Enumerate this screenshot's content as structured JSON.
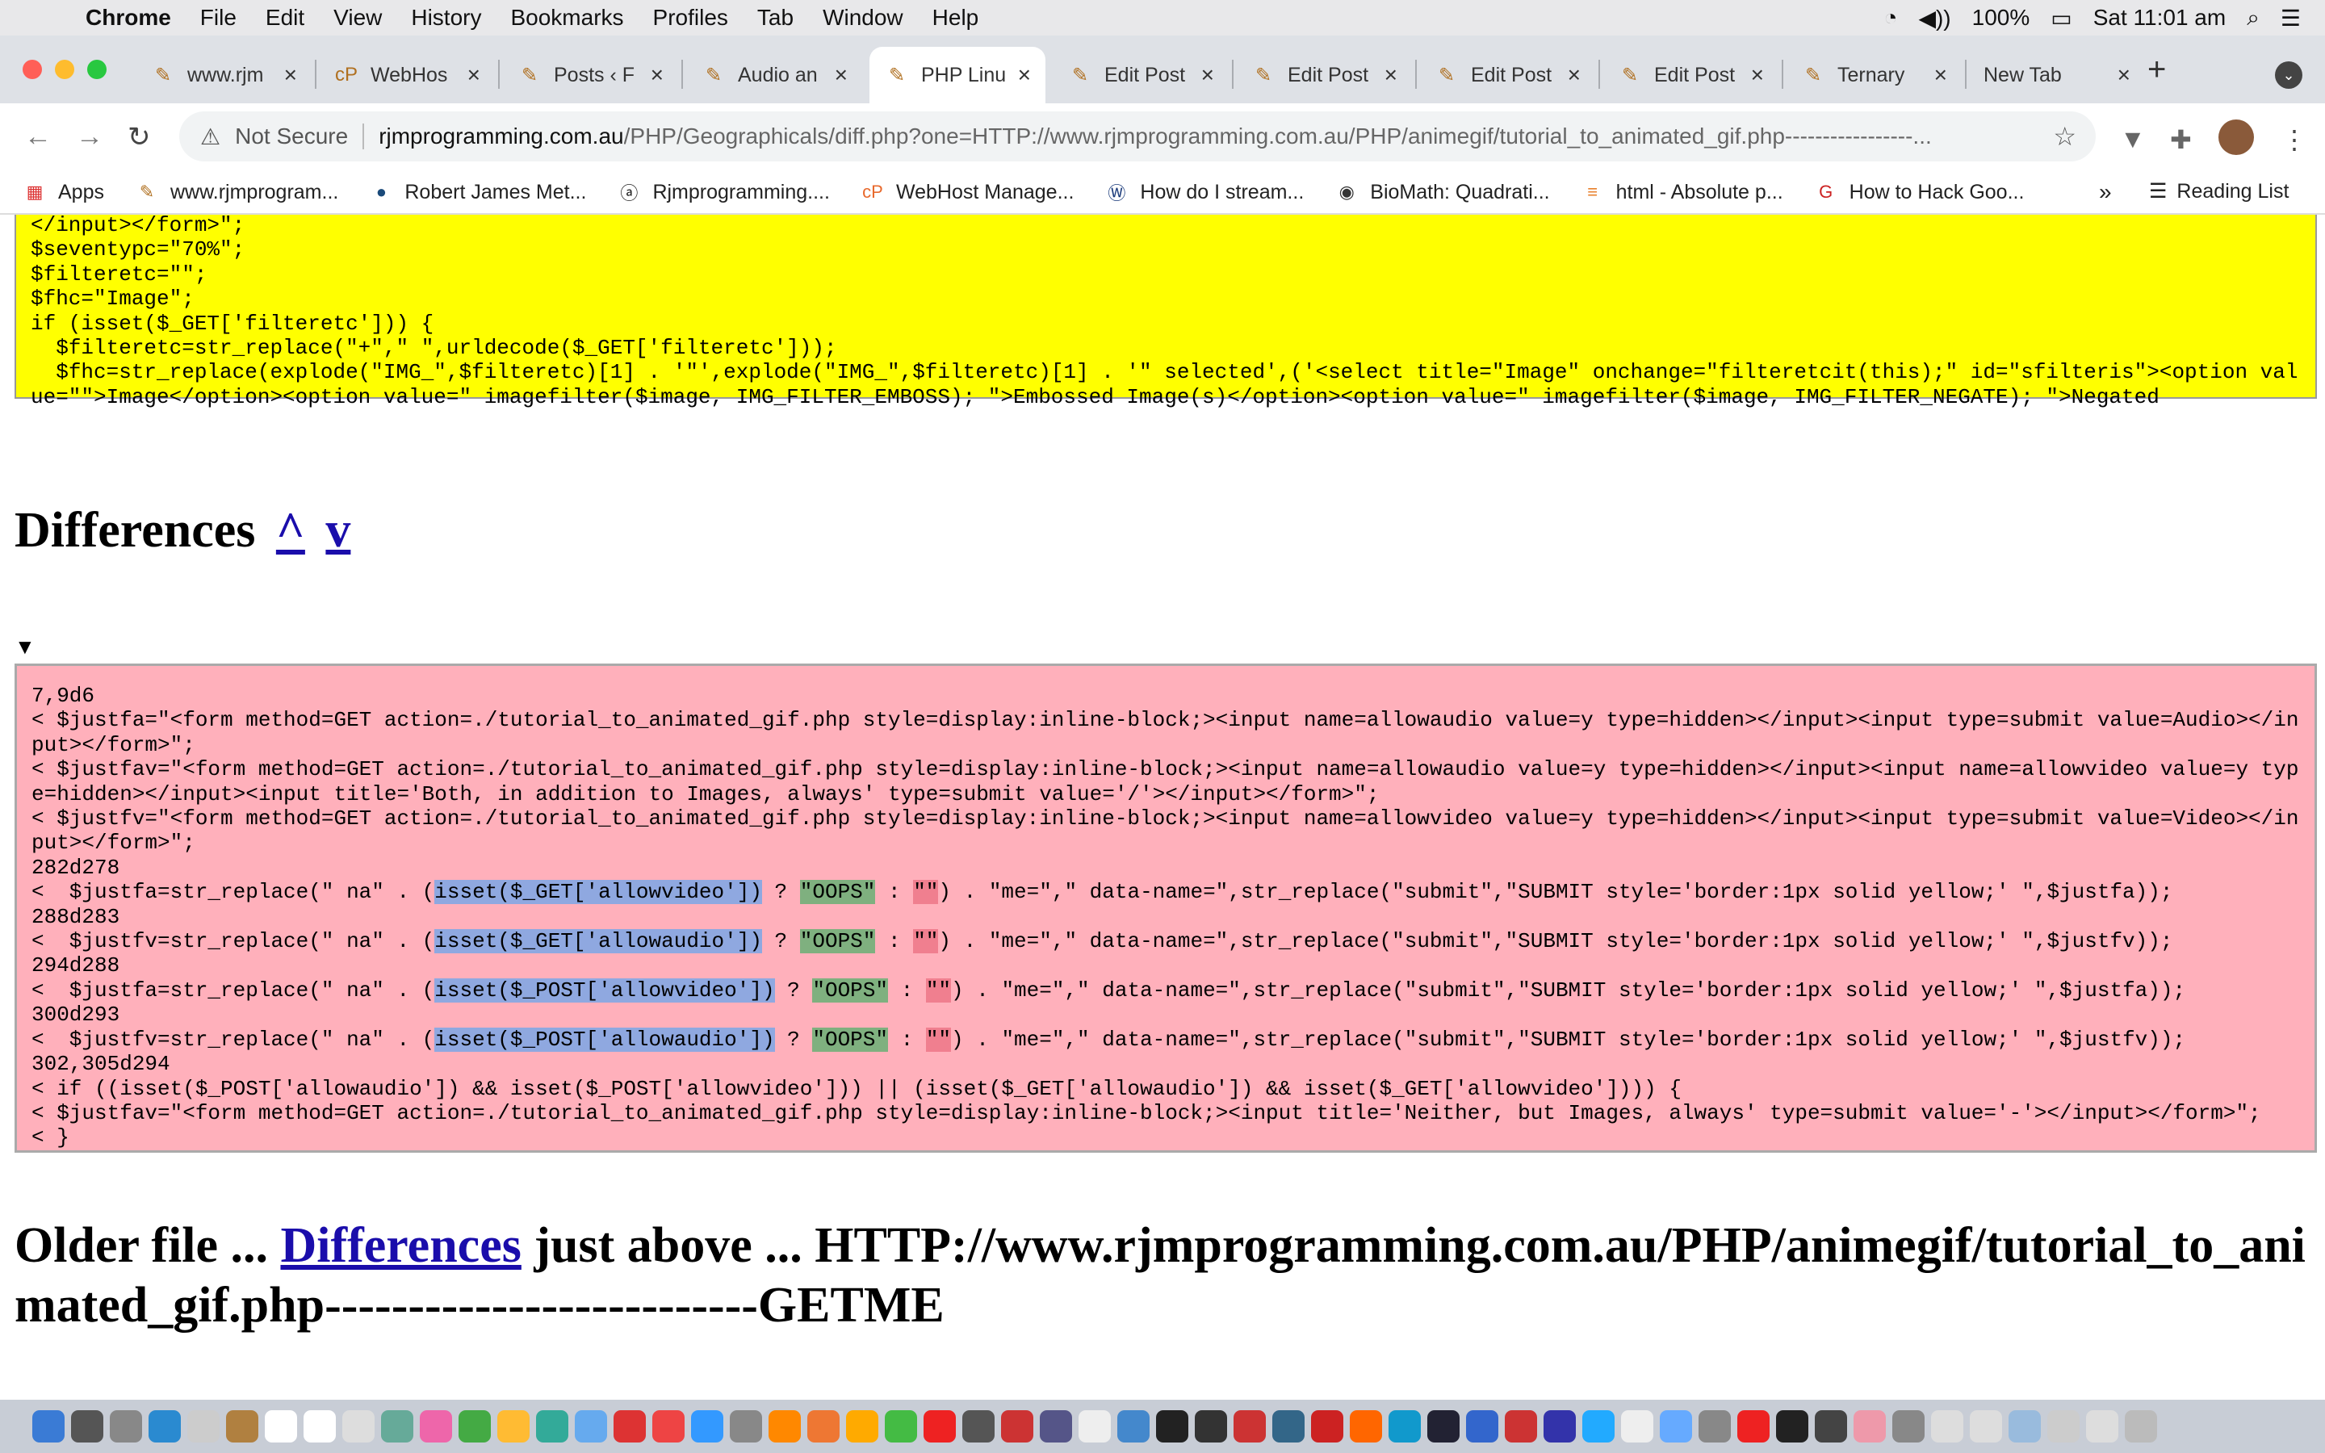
{
  "menubar": {
    "app": "Chrome",
    "items": [
      "File",
      "Edit",
      "View",
      "History",
      "Bookmarks",
      "Profiles",
      "Tab",
      "Window",
      "Help"
    ],
    "battery": "100%",
    "clock": "Sat 11:01 am"
  },
  "tabs": [
    {
      "label": "www.rjm",
      "fav": "✎"
    },
    {
      "label": "WebHos",
      "fav": "cP"
    },
    {
      "label": "Posts ‹ F",
      "fav": "✎"
    },
    {
      "label": "Audio an",
      "fav": "✎"
    },
    {
      "label": "PHP Linu",
      "fav": "✎",
      "active": true
    },
    {
      "label": "Edit Post",
      "fav": "✎"
    },
    {
      "label": "Edit Post",
      "fav": "✎"
    },
    {
      "label": "Edit Post",
      "fav": "✎"
    },
    {
      "label": "Edit Post",
      "fav": "✎"
    },
    {
      "label": "Ternary",
      "fav": "✎"
    },
    {
      "label": "New Tab",
      "fav": ""
    }
  ],
  "omnibox": {
    "security": "Not Secure",
    "host": "rjmprogramming.com.au",
    "path": "/PHP/Geographicals/diff.php?one=HTTP://www.rjmprogramming.com.au/PHP/animegif/tutorial_to_animated_gif.php-----------------..."
  },
  "bookmarks": [
    {
      "label": "Apps",
      "icon": "apps-grid-icon"
    },
    {
      "label": "www.rjmprogram...",
      "icon": "quill-icon"
    },
    {
      "label": "Robert James Met...",
      "icon": "circle-icon"
    },
    {
      "label": "Rjmprogramming....",
      "icon": "a-circle-icon"
    },
    {
      "label": "WebHost Manage...",
      "icon": "cpanel-icon"
    },
    {
      "label": "How do I stream...",
      "icon": "vw-icon"
    },
    {
      "label": "BioMath: Quadrati...",
      "icon": "globe-icon"
    },
    {
      "label": "html - Absolute p...",
      "icon": "stack-icon"
    },
    {
      "label": "How to Hack Goo...",
      "icon": "g-icon"
    }
  ],
  "bookmarks_more": "»",
  "reading_list": "Reading List",
  "yellow_code": "</input></form>\";\n$seventypc=\"70%\";\n$filteretc=\"\";\n$fhc=\"Image\";\nif (isset($_GET['filteretc'])) {\n  $filteretc=str_replace(\"+\",\" \",urldecode($_GET['filteretc']));\n  $fhc=str_replace(explode(\"IMG_\",$filteretc)[1] . '\"',explode(\"IMG_\",$filteretc)[1] . '\" selected',('<select title=\"Image\" onchange=\"filteretcit(this);\" id=\"sfilteris\"><option value=\"\">Image</option><option value=\" imagefilter($image, IMG_FILTER_EMBOSS); \">Embossed Image(s)</option><option value=\" imagefilter($image, IMG_FILTER_NEGATE); \">Negated",
  "diff_heading": "Differences",
  "diff_up": "^",
  "diff_down": "v",
  "triangle": "▼",
  "pink": {
    "l0": "7,9d6",
    "l1": "< $justfa=\"<form method=GET action=./tutorial_to_animated_gif.php style=display:inline-block;><input name=allowaudio value=y type=hidden></input><input type=submit value=Audio></input></form>\";",
    "l2": "< $justfav=\"<form method=GET action=./tutorial_to_animated_gif.php style=display:inline-block;><input name=allowaudio value=y type=hidden></input><input name=allowvideo value=y type=hidden></input><input title='Both, in addition to Images, always' type=submit value='/'></input></form>\";",
    "l3": "< $justfv=\"<form method=GET action=./tutorial_to_animated_gif.php style=display:inline-block;><input name=allowvideo value=y type=hidden></input><input type=submit value=Video></input></form>\";",
    "h1": "282d278",
    "a1": "<  $justfa=str_replace(\" na\" . (",
    "b1": "isset($_GET['allowvideo'])",
    "c1": " ? ",
    "d1": "\"OOPS\"",
    "e1": " : ",
    "f1": "\"\"",
    "g1": ") . \"me=\",\" data-name=\",str_replace(\"submit\",\"SUBMIT style='border:1px solid yellow;' \",$justfa));",
    "h2": "288d283",
    "a2": "<  $justfv=str_replace(\" na\" . (",
    "b2": "isset($_GET['allowaudio'])",
    "c2": " ? ",
    "d2": "\"OOPS\"",
    "e2": " : ",
    "f2": "\"\"",
    "g2": ") . \"me=\",\" data-name=\",str_replace(\"submit\",\"SUBMIT style='border:1px solid yellow;' \",$justfv));",
    "h3": "294d288",
    "a3": "<  $justfa=str_replace(\" na\" . (",
    "b3": "isset($_POST['allowvideo'])",
    "c3": " ? ",
    "d3": "\"OOPS\"",
    "e3": " : ",
    "f3": "\"\"",
    "g3": ") . \"me=\",\" data-name=\",str_replace(\"submit\",\"SUBMIT style='border:1px solid yellow;' \",$justfa));",
    "h4": "300d293",
    "a4": "<  $justfv=str_replace(\" na\" . (",
    "b4": "isset($_POST['allowaudio'])",
    "c4": " ? ",
    "d4": "\"OOPS\"",
    "e4": " : ",
    "f4": "\"\"",
    "g4": ") . \"me=\",\" data-name=\",str_replace(\"submit\",\"SUBMIT style='border:1px solid yellow;' \",$justfv));",
    "h5": "302,305d294",
    "l5": "< if ((isset($_POST['allowaudio']) && isset($_POST['allowvideo'])) || (isset($_GET['allowaudio']) && isset($_GET['allowvideo']))) {",
    "l6": "< $justfav=\"<form method=GET action=./tutorial_to_animated_gif.php style=display:inline-block;><input title='Neither, but Images, always' type=submit value='-'></input></form>\";",
    "l7": "< }"
  },
  "older": {
    "pre": "Older file ... ",
    "link": "Differences",
    "post": " just above ... HTTP://www.rjmprogramming.com.au/PHP/animegif/tutorial_to_animated_gif.php--------------------------GETME"
  },
  "colors": {
    "yellow": "#ffff00",
    "pink": "#ffb0bb",
    "link": "#1a0dab"
  }
}
